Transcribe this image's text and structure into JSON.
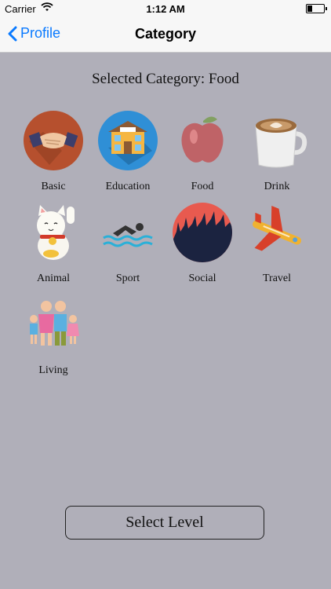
{
  "status_bar": {
    "carrier": "Carrier",
    "time": "1:12 AM"
  },
  "nav": {
    "back_label": "Profile",
    "title": "Category"
  },
  "selected_text": "Selected Category: Food",
  "categories": [
    {
      "label": "Basic",
      "icon": "handshake-icon"
    },
    {
      "label": "Education",
      "icon": "school-icon"
    },
    {
      "label": "Food",
      "icon": "apple-icon"
    },
    {
      "label": "Drink",
      "icon": "coffee-cup-icon"
    },
    {
      "label": "Animal",
      "icon": "lucky-cat-icon"
    },
    {
      "label": "Sport",
      "icon": "swimmer-icon"
    },
    {
      "label": "Social",
      "icon": "crowd-icon"
    },
    {
      "label": "Travel",
      "icon": "airplane-icon"
    },
    {
      "label": "Living",
      "icon": "family-icon"
    }
  ],
  "select_button_label": "Select Level"
}
